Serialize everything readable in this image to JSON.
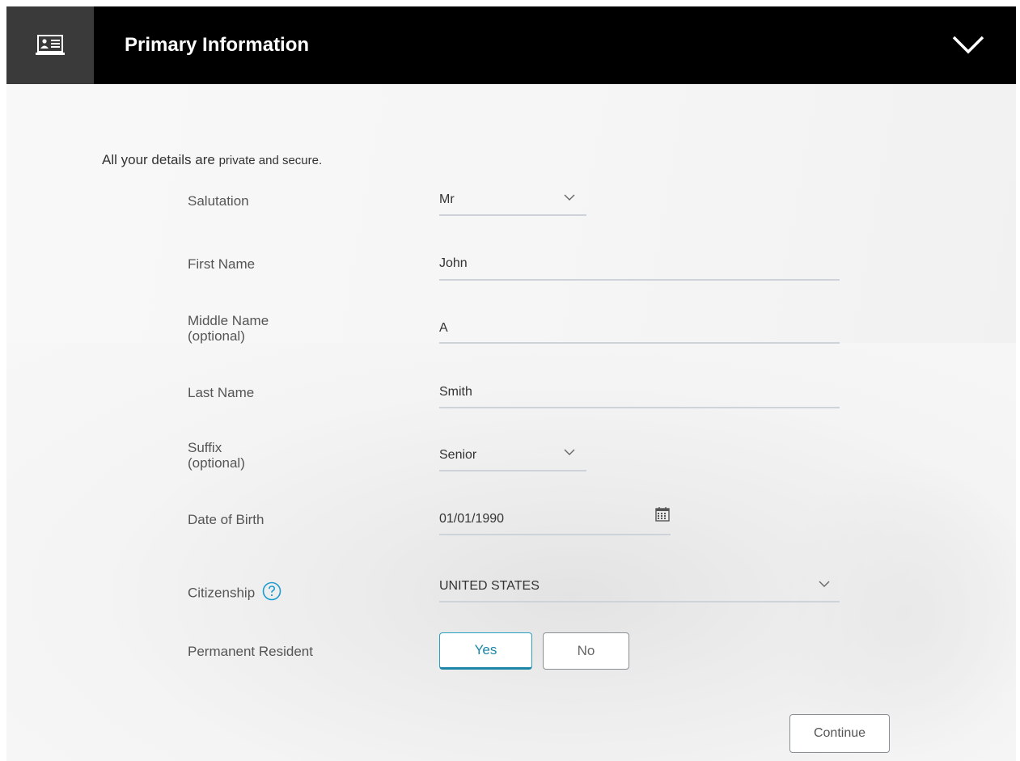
{
  "header": {
    "title": "Primary Information",
    "icon": "id-card-icon",
    "collapse_icon": "chevron-down-icon"
  },
  "note": {
    "main": "All your details are",
    "small": "private and secure."
  },
  "form": {
    "salutation": {
      "label": "Salutation",
      "value": "Mr"
    },
    "first_name": {
      "label": "First Name",
      "value": "John"
    },
    "middle_name": {
      "label_line1": "Middle Name",
      "label_line2": "(optional)",
      "value": "A"
    },
    "last_name": {
      "label": "Last Name",
      "value": "Smith"
    },
    "suffix": {
      "label_line1": "Suffix",
      "label_line2": "(optional)",
      "value": "Senior"
    },
    "dob": {
      "label": "Date of Birth",
      "value": "01/01/1990"
    },
    "citizenship": {
      "label": "Citizenship",
      "value": "UNITED STATES"
    },
    "permanent_resident": {
      "label": "Permanent Resident",
      "yes": "Yes",
      "no": "No",
      "selected": "Yes"
    }
  },
  "actions": {
    "continue": "Continue"
  },
  "colors": {
    "accent": "#1b86a8",
    "header_bg": "#000000",
    "icon_box_bg": "#3a3a3a"
  }
}
